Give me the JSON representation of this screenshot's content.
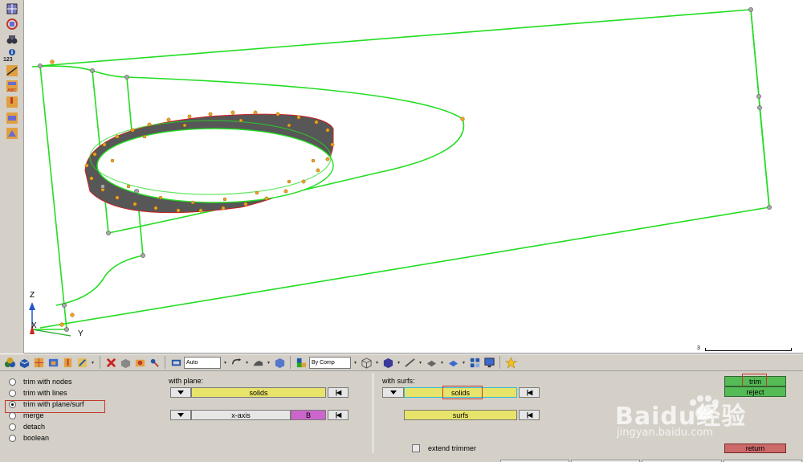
{
  "left_toolbar": {
    "icons": [
      "component-icon",
      "mesh-icon",
      "binoculars-icon",
      "info-icon",
      "measure-icon",
      "label-icon",
      "label-red-icon",
      "mask-icon",
      "plane-icon"
    ],
    "info_caption": "123",
    "label_caption": "ABC"
  },
  "viewport": {
    "triad": {
      "z": "Z",
      "x": "X",
      "y": "Y"
    },
    "scale_value": "3",
    "colors": {
      "wireframe": "#22dd22",
      "node": "#f0a020",
      "ring": "#555555",
      "ring_edge": "#cc2222"
    }
  },
  "toolbar": {
    "visualization_select": "Auto",
    "color_by_select": "By Comp"
  },
  "panel": {
    "options": [
      {
        "label": "trim with nodes",
        "selected": false
      },
      {
        "label": "trim with lines",
        "selected": false
      },
      {
        "label": "trim with plane/surf",
        "selected": true
      },
      {
        "label": "merge",
        "selected": false
      },
      {
        "label": "detach",
        "selected": false
      },
      {
        "label": "boolean",
        "selected": false
      }
    ],
    "with_plane": {
      "label": "with plane:",
      "entity_button": "solids",
      "plane_axis": "x-axis",
      "base_button": "B"
    },
    "with_surfs": {
      "label": "with surfs:",
      "entity_button": "solids",
      "surfs_button": "surfs"
    },
    "extend_trimmer_label": "extend trimmer",
    "actions": {
      "trim": "trim",
      "reject": "reject",
      "return": "return"
    }
  },
  "watermark": {
    "brand": "Baidu经验",
    "url": "jingyan.baidu.com"
  }
}
